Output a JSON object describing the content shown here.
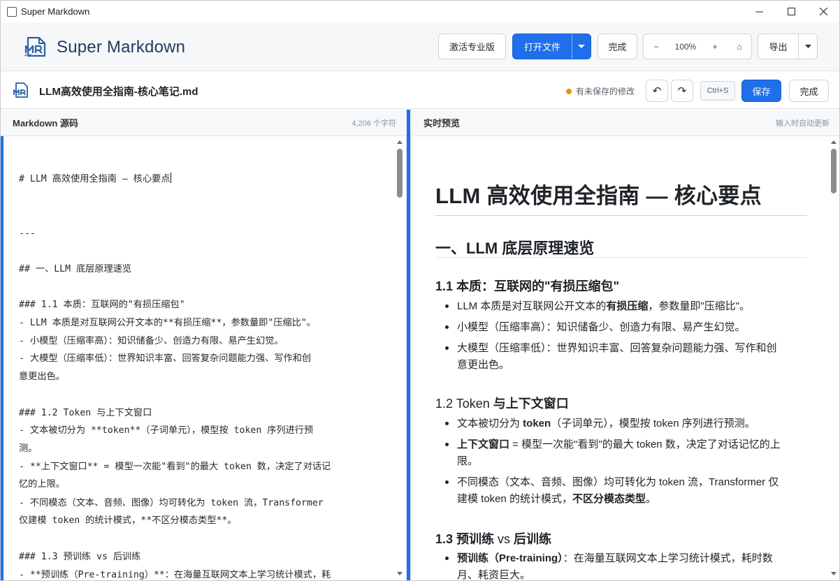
{
  "window": {
    "title": "Super Markdown"
  },
  "header": {
    "app_name": "Super Markdown",
    "activate_label": "激活专业版",
    "open_file_label": "打开文件",
    "done_label": "完成",
    "zoom_out": "−",
    "zoom_level": "100%",
    "zoom_in": "+",
    "zoom_reset": "⌂",
    "export_label": "导出"
  },
  "filebar": {
    "filename": "LLM高效使用全指南-核心笔记.md",
    "unsaved_text": "有未保存的修改",
    "undo": "↶",
    "redo": "↷",
    "shortcut": "Ctrl+S",
    "save_label": "保存",
    "done_label": "完成"
  },
  "editor": {
    "pane_title": "Markdown 源码",
    "char_count": "4,206 个字符",
    "lines": [
      "# LLM 高效使用全指南 — 核心要点",
      "---",
      "## 一、LLM 底层原理速览",
      "### 1.1 本质：互联网的\"有损压缩包\"",
      "- LLM 本质是对互联网公开文本的**有损压缩**，参数量即\"压缩比\"。",
      "- 小模型（压缩率高）：知识储备少、创造力有限、易产生幻觉。",
      "- 大模型（压缩率低）：世界知识丰富、回答复杂问题能力强、写作和创",
      "意更出色。",
      "### 1.2 Token 与上下文窗口",
      "- 文本被切分为 **token**（子词单元），模型按 token 序列进行预",
      "测。",
      "- **上下文窗口** = 模型一次能\"看到\"的最大 token 数，决定了对话记",
      "忆的上限。",
      "- 不同模态（文本、音频、图像）均可转化为 token 流，Transformer",
      "仅建模 token 的统计模式，**不区分模态类型**。",
      "### 1.3 预训练 vs 后训练",
      "- **预训练（Pre-training）**：在海量互联网文本上学习统计模式，耗"
    ]
  },
  "preview": {
    "pane_title": "实时预览",
    "meta": "输入时自动更新",
    "h1": "LLM 高效使用全指南 — 核心要点",
    "h2": "一、LLM 底层原理速览",
    "s1_title": "1.1 本质：互联网的\"有损压缩包\"",
    "s1_li1_a": "LLM 本质是对互联网公开文本的",
    "s1_li1_b": "有损压缩",
    "s1_li1_c": "，参数量即\"压缩比\"。",
    "s1_li2": "小模型（压缩率高）：知识储备少、创造力有限、易产生幻觉。",
    "s1_li3_l1": "大模型（压缩率低）：世界知识丰富、回答复杂问题能力强、写作和创",
    "s1_li3_l2": "意更出色。",
    "s2_title_a": "1.2 Token ",
    "s2_title_b": "与上下文窗口",
    "s2_li1_a": "文本被切分为 ",
    "s2_li1_b": "token",
    "s2_li1_c": "（子词单元），模型按 token 序列进行预测。",
    "s2_li2_a": "上下文窗口",
    "s2_li2_b": " = 模型一次能\"看到\"的最大 token 数，决定了对话记忆的上",
    "s2_li2_l2": "限。",
    "s2_li3_l1": "不同模态（文本、音频、图像）均可转化为 token 流，Transformer 仅",
    "s2_li3_l2a": "建模 token 的统计模式，",
    "s2_li3_l2b": "不区分模态类型",
    "s2_li3_l2c": "。",
    "s3_title_a": "1.3 预训练 ",
    "s3_title_b": "vs",
    "s3_title_c": " 后训练",
    "s3_li1_a": "预训练（Pre-training）",
    "s3_li1_b": "：在海量互联网文本上学习统计模式，耗时数",
    "s3_li1_l2": "月、耗资巨大。"
  },
  "colors": {
    "accent": "#1f6feb",
    "unsaved_dot": "#e69500",
    "brand": "#1f3a5f"
  }
}
